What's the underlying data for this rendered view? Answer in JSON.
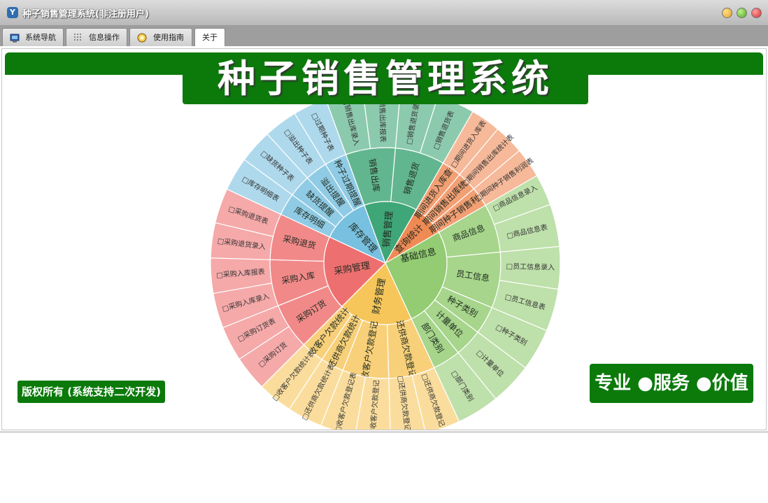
{
  "window": {
    "title": "种子销售管理系统(非注册用户)"
  },
  "tabs": [
    {
      "label": "系统导航",
      "icon": "monitor-icon"
    },
    {
      "label": "信息操作",
      "icon": "grid-icon"
    },
    {
      "label": "使用指南",
      "icon": "help-icon"
    },
    {
      "label": "关于",
      "icon": ""
    }
  ],
  "banner": {
    "title": "种子销售管理系统"
  },
  "footer": {
    "copyright": "版权所有 (系统支持二次开发)",
    "slogan": "专业 ●服务 ●价值"
  },
  "colors": {
    "brand_green": "#0b7a0b",
    "basic": "#93cc72",
    "finance": "#f6c65b",
    "purchase": "#ee6f6f",
    "inventory": "#78c0df",
    "sales": "#3fa677",
    "query": "#f08a55"
  },
  "menu": [
    {
      "name": "基础信息",
      "color": "#93cc72",
      "a0": -90,
      "a1": 65,
      "children": [
        {
          "name": "供商信息",
          "leaves": [
            "供商信息录入",
            "供商信息表"
          ]
        },
        {
          "name": "客户信息",
          "leaves": [
            "客户信息录入",
            "客户信息表"
          ]
        },
        {
          "name": "商品信息",
          "leaves": [
            "商品信息录入",
            "商品信息表"
          ]
        },
        {
          "name": "员工信息",
          "leaves": [
            "员工信息录入",
            "员工信息表"
          ]
        },
        {
          "name": "种子类别",
          "leaves": [
            "种子类别"
          ]
        },
        {
          "name": "计量单位",
          "leaves": [
            "计量单位"
          ]
        },
        {
          "name": "部门类别",
          "leaves": [
            "部门类别"
          ]
        }
      ]
    },
    {
      "name": "财务管理",
      "color": "#f6c65b",
      "a0": 65,
      "a1": 135,
      "children": [
        {
          "name": "还供商欠款登记",
          "leaves": [
            "还供商欠款登记",
            "还供商欠款登记表"
          ]
        },
        {
          "name": "收客户欠款登记",
          "leaves": [
            "收客户欠款登记",
            "收客户欠款登记表"
          ]
        },
        {
          "name": "还供商欠款统计",
          "leaves": [
            "还供商欠款统计表"
          ]
        },
        {
          "name": "收客户欠款统计",
          "leaves": [
            "收客户欠款统计表"
          ]
        }
      ]
    },
    {
      "name": "采购管理",
      "color": "#ee6f6f",
      "a0": 135,
      "a1": 205,
      "children": [
        {
          "name": "采购订货",
          "leaves": [
            "采购订货",
            "采购订货表"
          ]
        },
        {
          "name": "采购入库",
          "leaves": [
            "采购入库录入",
            "采购入库报表"
          ]
        },
        {
          "name": "采购退货",
          "leaves": [
            "采购退货录入",
            "采购退货表"
          ]
        }
      ]
    },
    {
      "name": "库存管理",
      "color": "#78c0df",
      "a0": 205,
      "a1": 250,
      "children": [
        {
          "name": "库存明细",
          "leaves": [
            "库存明细表"
          ]
        },
        {
          "name": "缺货提醒",
          "leaves": [
            "缺货种子表"
          ]
        },
        {
          "name": "溢出提醒",
          "leaves": [
            "溢出种子表"
          ]
        },
        {
          "name": "种子过期提醒",
          "leaves": [
            "过期种子表"
          ]
        }
      ]
    },
    {
      "name": "销售管理",
      "color": "#3fa677",
      "a0": 250,
      "a1": 300,
      "children": [
        {
          "name": "销售出库",
          "leaves": [
            "销售出库录入",
            "销售出库报表"
          ]
        },
        {
          "name": "销售退货",
          "leaves": [
            "销售退货录入",
            "销售退货表"
          ]
        }
      ]
    },
    {
      "name": "查询统计",
      "color": "#f08a55",
      "a0": 300,
      "a1": 330,
      "children": [
        {
          "name": "期间进货入库查询",
          "leaves": [
            "期间进货入库表"
          ]
        },
        {
          "name": "期间销售出库统计",
          "leaves": [
            "期间销售出库统计表"
          ]
        },
        {
          "name": "期间种子销售利润",
          "leaves": [
            "期间种子销售利润表"
          ]
        }
      ]
    }
  ]
}
